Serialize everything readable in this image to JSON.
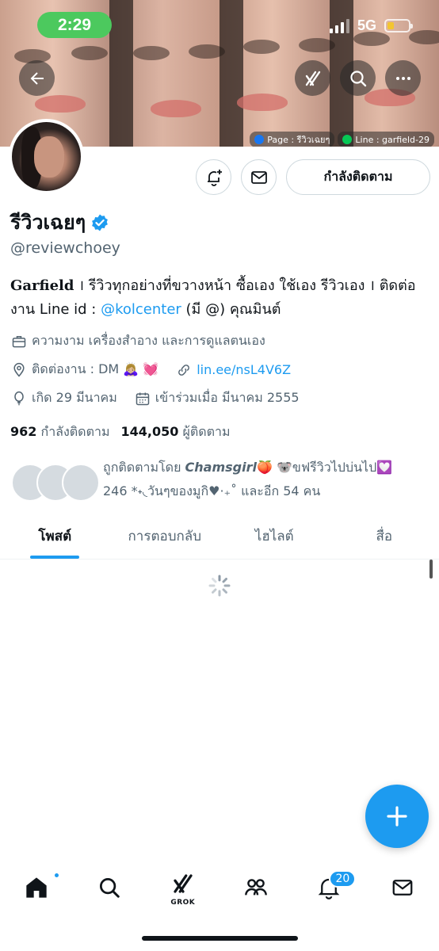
{
  "status_bar": {
    "time": "2:29",
    "network": "5G"
  },
  "banner": {
    "tag_page": "Page : รีวิวเฉยๆ",
    "tag_line": "Line : garfield-29"
  },
  "profile": {
    "display_name": "รีวิวเฉยๆ",
    "handle": "@reviewchoey",
    "follow_label": "กำลังติดตาม",
    "bio": {
      "part1_bold": "Garfield",
      "part2": " । รีวิวทุกอย่างที่ขวางหน้า ซื้อเอง ใช้เอง รีวิวเอง । ติดต่องาน Line id : ",
      "link": "@kolcenter",
      "part3": " (มี @) คุณมินต์"
    },
    "category": "ความงาม เครื่องสำอาง และการดูแลตนเอง",
    "contact": "ติดต่องาน : DM 🙇🏼‍♀️ 💓",
    "website": "lin.ee/nsL4V6Z",
    "birthday": "เกิด 29 มีนาคม",
    "joined": "เข้าร่วมเมื่อ มีนาคม 2555",
    "following_count": "962",
    "following_label": "กำลังติดตาม",
    "followers_count": "144,050",
    "followers_label": "ผู้ติดตาม",
    "followed_by": {
      "prefix": "ถูกติดตามโดย ",
      "name1": "Chamsgirl",
      "rest1": "🍑 🐨ขฟรีวิวไปบ่นไป💟",
      "line2": "246 *˖◟วันๆของมูกิ♥︎·₊˚ และอีก 54 คน"
    }
  },
  "tabs": [
    "โพสต์",
    "การตอบกลับ",
    "ไฮไลต์",
    "สื่อ"
  ],
  "nav": {
    "notifications_badge": "20",
    "grok_label": "GROK"
  },
  "colors": {
    "accent": "#1d9bf0",
    "text": "#0f1419",
    "muted": "#536471"
  }
}
